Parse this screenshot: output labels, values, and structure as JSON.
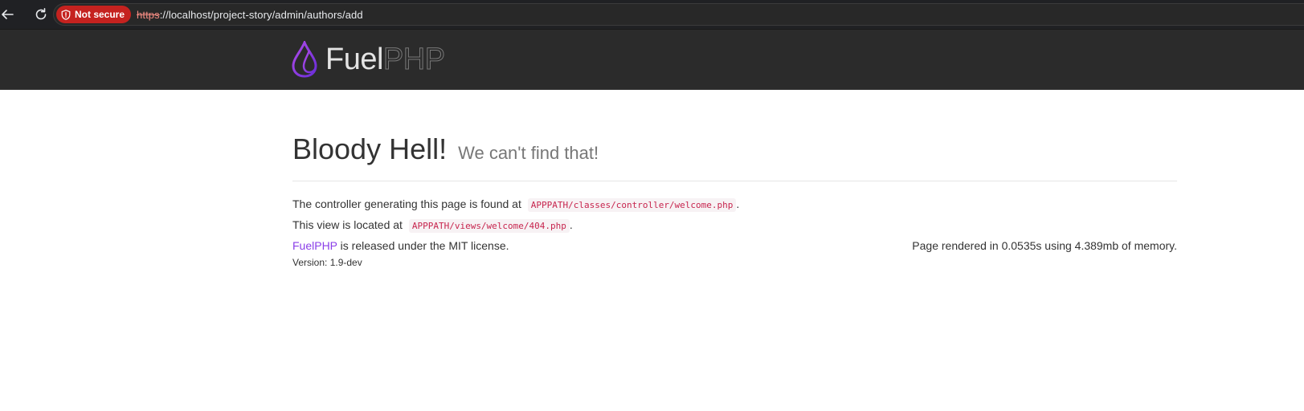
{
  "browser": {
    "security_label": "Not secure",
    "url_scheme": "https",
    "url_rest": "://localhost/project-story/admin/authors/add"
  },
  "header": {
    "logo_fuel": "Fuel",
    "logo_php": "PHP"
  },
  "main": {
    "title": "Bloody Hell!",
    "subtitle": "We can't find that!",
    "controller_text": "The controller generating this page is found at",
    "controller_path": "APPPATH/classes/controller/welcome.php",
    "view_text": "This view is located at",
    "view_path": "APPPATH/views/welcome/404.php",
    "period": ".",
    "fuel_link": "FuelPHP",
    "license_text": "is released under the MIT license.",
    "render_info": "Page rendered in 0.0535s using 4.389mb of memory.",
    "version": "Version: 1.9-dev"
  },
  "colors": {
    "brand_purple": "#8a3ee8",
    "insecure_red": "#c5221f",
    "code_pink": "#c7254e"
  }
}
